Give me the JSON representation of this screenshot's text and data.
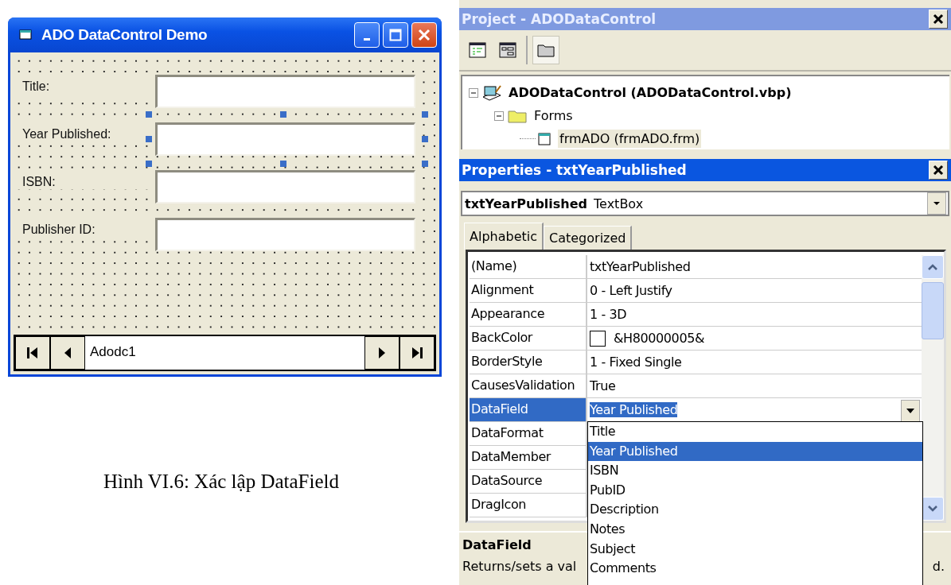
{
  "form_window": {
    "title": "ADO DataControl Demo",
    "fields": [
      {
        "label": "Title:",
        "selected": false
      },
      {
        "label": "Year Published:",
        "selected": true
      },
      {
        "label": "ISBN:",
        "selected": false
      },
      {
        "label": "Publisher ID:",
        "selected": false
      }
    ],
    "data_control": {
      "caption": "Adodc1"
    }
  },
  "caption": "Hình VI.6: Xác lập DataField",
  "project_panel": {
    "title": "Project - ADODataControl",
    "active": false,
    "tree": [
      {
        "kind": "project",
        "label": "ADODataControl (ADODataControl.vbp)",
        "expanded": true,
        "selected": false,
        "children": [
          {
            "kind": "folder",
            "label": "Forms",
            "expanded": true,
            "selected": false,
            "children": [
              {
                "kind": "form",
                "label": "frmADO (frmADO.frm)",
                "selected": true
              }
            ]
          }
        ]
      }
    ]
  },
  "properties_panel": {
    "title": "Properties - txtYearPublished",
    "active": true,
    "object": {
      "name": "txtYearPublished",
      "type": "TextBox"
    },
    "tabs": [
      {
        "label": "Alphabetic",
        "selected": true
      },
      {
        "label": "Categorized",
        "selected": false
      }
    ],
    "rows": [
      {
        "kind": "text",
        "name": "(Name)",
        "value": "txtYearPublished",
        "selected": false
      },
      {
        "kind": "text",
        "name": "Alignment",
        "value": "0 - Left Justify",
        "selected": false
      },
      {
        "kind": "text",
        "name": "Appearance",
        "value": "1 - 3D",
        "selected": false
      },
      {
        "kind": "color",
        "name": "BackColor",
        "value": "&H80000005&",
        "color": "#ffffff",
        "selected": false
      },
      {
        "kind": "text",
        "name": "BorderStyle",
        "value": "1 - Fixed Single",
        "selected": false
      },
      {
        "kind": "text",
        "name": "CausesValidation",
        "value": "True",
        "selected": false
      },
      {
        "kind": "dropdown",
        "name": "DataField",
        "value": "Year Published",
        "selected": true,
        "options": [
          {
            "label": "Title",
            "selected": false
          },
          {
            "label": "Year Published",
            "selected": true
          },
          {
            "label": "ISBN",
            "selected": false
          },
          {
            "label": "PubID",
            "selected": false
          },
          {
            "label": "Description",
            "selected": false
          },
          {
            "label": "Notes",
            "selected": false
          },
          {
            "label": "Subject",
            "selected": false
          },
          {
            "label": "Comments",
            "selected": false
          }
        ]
      },
      {
        "kind": "text",
        "name": "DataFormat",
        "selected": false
      },
      {
        "kind": "text",
        "name": "DataMember",
        "selected": false
      },
      {
        "kind": "text",
        "name": "DataSource",
        "selected": false
      },
      {
        "kind": "text",
        "name": "DragIcon",
        "selected": false
      }
    ],
    "description": {
      "title": "DataField",
      "text_left": "Returns/sets a val",
      "text_right": "d."
    }
  }
}
